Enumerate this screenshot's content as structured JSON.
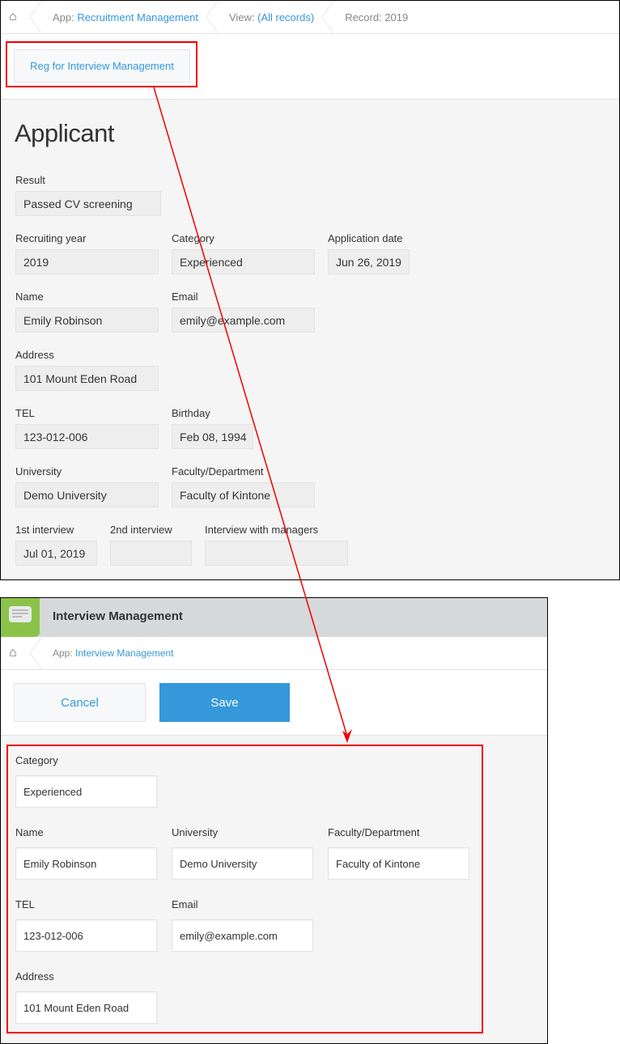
{
  "record_window": {
    "breadcrumb": {
      "app_prefix": "App: ",
      "app_name": "Recruitment Management",
      "view_prefix": "View: ",
      "view_name": "(All records)",
      "record": "Record: 2019"
    },
    "action_button": "Reg for Interview Management",
    "title": "Applicant",
    "fields": [
      {
        "label": "Result",
        "value": "Passed CV screening"
      },
      {
        "label": "Recruiting year",
        "value": "2019"
      },
      {
        "label": "Category",
        "value": "Experienced"
      },
      {
        "label": "Application date",
        "value": "Jun 26, 2019"
      },
      {
        "label": "Name",
        "value": "Emily Robinson"
      },
      {
        "label": "Email",
        "value": "emily@example.com"
      },
      {
        "label": "Address",
        "value": "101 Mount Eden Road"
      },
      {
        "label": "TEL",
        "value": "123-012-006"
      },
      {
        "label": "Birthday",
        "value": "Feb 08, 1994"
      },
      {
        "label": "University",
        "value": "Demo University"
      },
      {
        "label": "Faculty/Department",
        "value": "Faculty of Kintone"
      },
      {
        "label": "1st interview",
        "value": "Jul 01, 2019"
      },
      {
        "label": "2nd interview",
        "value": ""
      },
      {
        "label": "Interview with managers",
        "value": ""
      }
    ]
  },
  "form_window": {
    "app_title": "Interview Management",
    "breadcrumb": {
      "app_prefix": "App: ",
      "app_name": "Interview Management"
    },
    "cancel_label": "Cancel",
    "save_label": "Save",
    "fields": [
      {
        "label": "Category",
        "value": "Experienced"
      },
      {
        "label": "Name",
        "value": "Emily Robinson"
      },
      {
        "label": "University",
        "value": "Demo University"
      },
      {
        "label": "Faculty/Department",
        "value": "Faculty of Kintone"
      },
      {
        "label": "TEL",
        "value": "123-012-006"
      },
      {
        "label": "Email",
        "value": "emily@example.com"
      },
      {
        "label": "Address",
        "value": "101 Mount Eden Road"
      }
    ]
  },
  "colors": {
    "accent": "#3498db",
    "annotation": "#ee0000"
  }
}
